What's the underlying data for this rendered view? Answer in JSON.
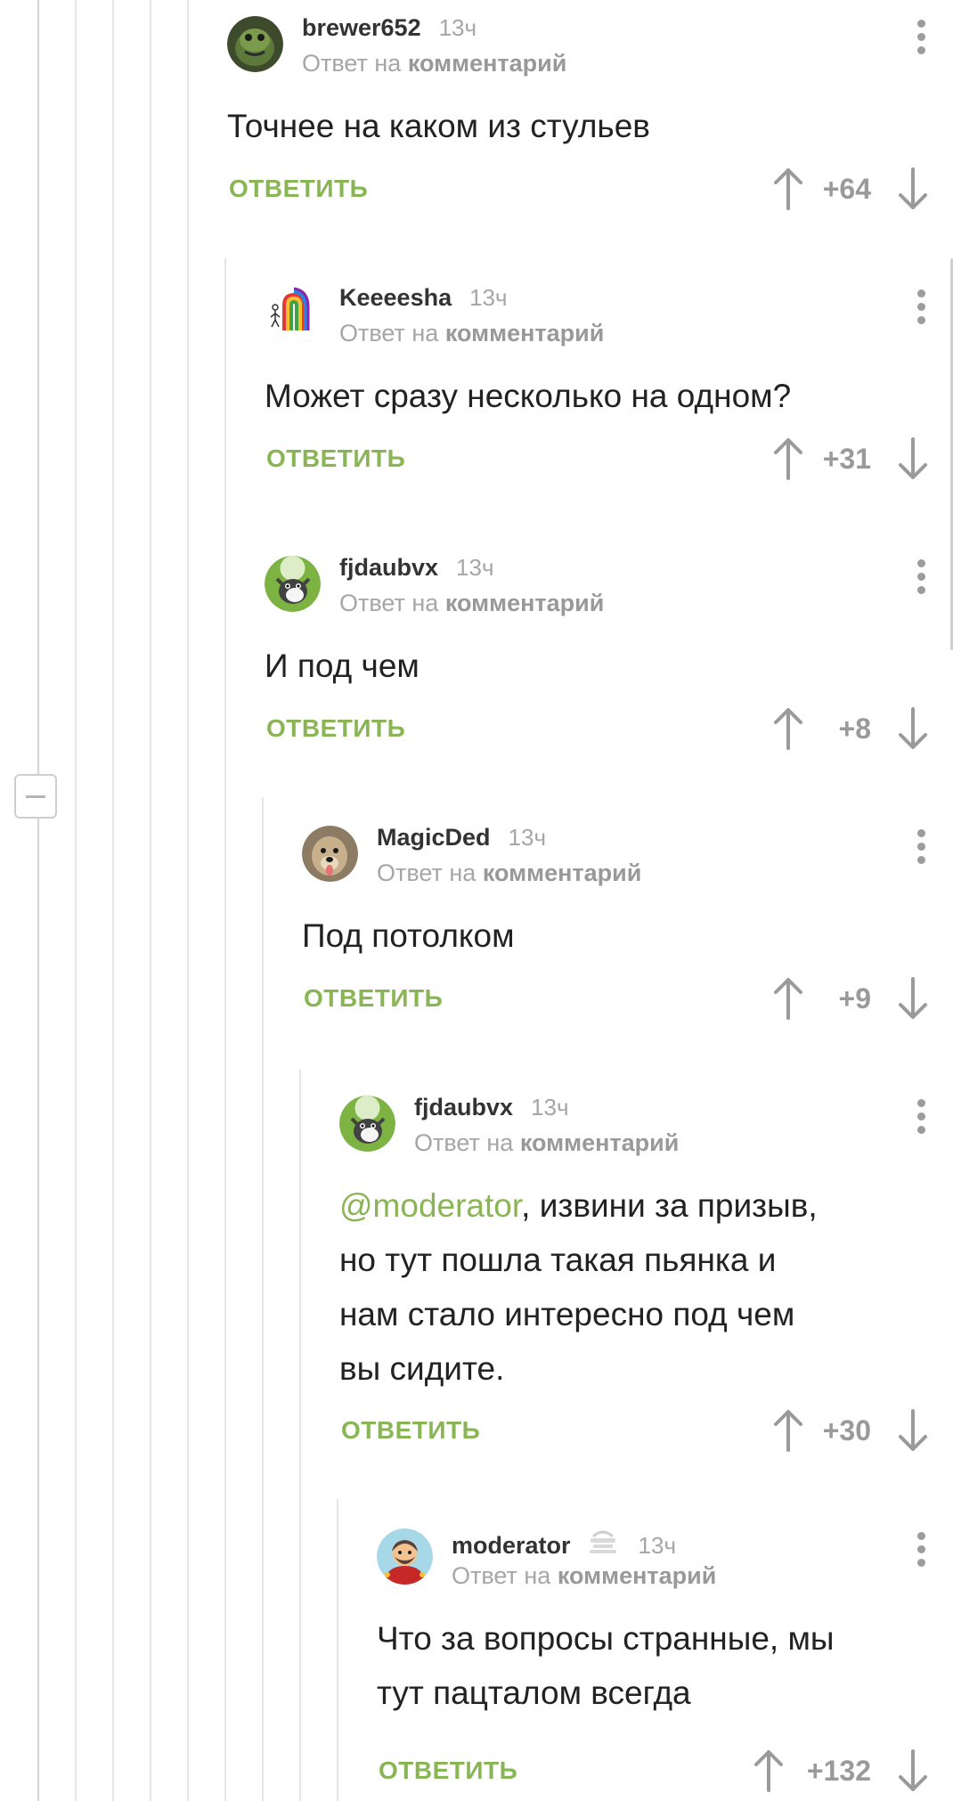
{
  "reply_to_prefix": "Ответ на",
  "reply_to_link": "комментарий",
  "reply_label": "ОТВЕТИТЬ",
  "comments": [
    {
      "username": "brewer652",
      "time": "13ч",
      "text": "Точнее на каком из стульев",
      "score": "+64"
    },
    {
      "username": "Keeeesha",
      "time": "13ч",
      "text": "Может сразу несколько на одном?",
      "score": "+31"
    },
    {
      "username": "fjdaubvx",
      "time": "13ч",
      "text": "И под чем",
      "score": "+8"
    },
    {
      "username": "MagicDed",
      "time": "13ч",
      "text": "Под потолком",
      "score": "+9"
    },
    {
      "username": "fjdaubvx",
      "time": "13ч",
      "mention": "@moderator",
      "text_line1": ", извини за призыв,",
      "text_line2": "но тут пошла такая пьянка и",
      "text_line3": "нам стало интересно под чем",
      "text_line4": "вы сидите.",
      "score": "+30"
    },
    {
      "username": "moderator",
      "time": "13ч",
      "badge_icon": "moderator-cake-icon",
      "text_line1": "Что за вопросы странные, мы",
      "text_line2": "тут пацталом всегда",
      "score": "+132"
    }
  ],
  "colors": {
    "accent_green": "#8ab554",
    "text": "#222222",
    "muted": "#a6a6a6",
    "thread_line": "#e6e6e6"
  }
}
